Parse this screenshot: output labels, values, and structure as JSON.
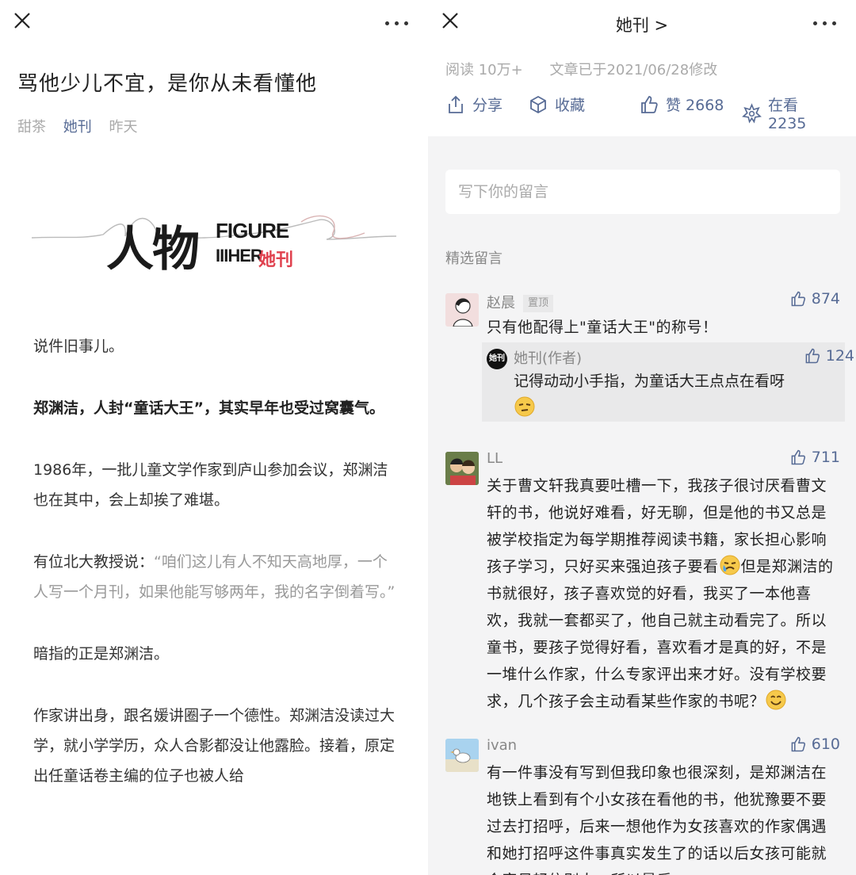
{
  "left": {
    "title": "骂他少儿不宜，是你从未看懂他",
    "author": "甜茶",
    "account": "她刊",
    "date": "昨天",
    "banner_cn": "人物",
    "banner_en_top": "FIGURE",
    "banner_en_bottom": "IIIHER",
    "banner_brand": "她刊",
    "paragraphs": [
      "说件旧事儿。",
      "郑渊洁，人封“童话大王”，其实早年也受过窝囊气。",
      "1986年，一批儿童文学作家到庐山参加会议，郑渊洁也在其中，会上却挨了难堪。",
      "暗指的正是郑渊洁。",
      "作家讲出身，跟名媛讲圈子一个德性。郑渊洁没读过大学，就小学学历，众人合影都没让他露脸。接着，原定出任童话卷主编的位子也被人给"
    ],
    "quote_lead": "有位北大教授说：",
    "quote": "“咱们这儿有人不知天高地厚，一个人写一个月刊，如果他能写够两年，我的名字倒着写。”"
  },
  "right": {
    "account_title": "她刊 >",
    "reads": "阅读 10万+",
    "modified": "文章已于2021/06/28修改",
    "share": "分享",
    "collect": "收藏",
    "like": "赞 2668",
    "watching": "在看 2235",
    "comment_placeholder": "写下你的留言",
    "selected_title": "精选留言",
    "comments": [
      {
        "name": "赵晨",
        "pinned": "置顶",
        "likes": "874",
        "text": "只有他配得上\"童话大王\"的称号！",
        "reply": {
          "name": "她刊(作者)",
          "avatar_text": "她刊",
          "likes": "124",
          "text": "记得动动小手指，为童话大王点点在看呀"
        }
      },
      {
        "name": "LL",
        "likes": "711",
        "text_a": "关于曹文轩我真要吐槽一下，我孩子很讨厌看曹文轩的书，他说好难看，好无聊，但是他的书又总是被学校指定为每学期推荐阅读书籍，家长担心影响孩子学习，只好买来强迫孩子要看",
        "text_b": "但是郑渊洁的书就很好，孩子喜欢觉的好看，我买了一本他喜欢，我就一套都买了，他自己就主动看完了。所以童书，要孩子觉得好看，喜欢看才是真的好，不是一堆什么作家，什么专家评出来才好。没有学校要求，几个孩子会主动看某些作家的书呢？"
      },
      {
        "name": "ivan",
        "likes": "610",
        "text": "有一件事没有写到但我印象也很深刻，是郑渊洁在地铁上看到有个小女孩在看他的书，他犹豫要不要过去打招呼，后来一想他作为女孩喜欢的作家偶遇和她打招呼这件事真实发生了的话以后女孩可能就会容易轻信别人，所以最后"
      }
    ],
    "accent": "#576b95"
  }
}
